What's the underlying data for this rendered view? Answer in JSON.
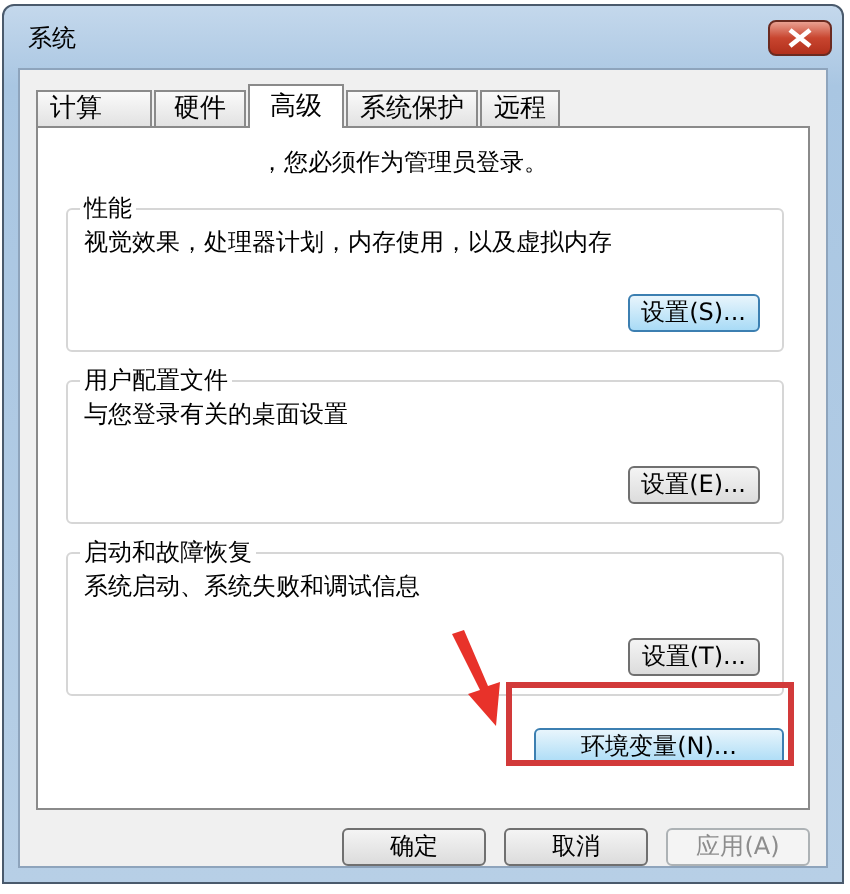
{
  "window": {
    "title": "系统"
  },
  "tabs": [
    {
      "label": "计算",
      "selected": false
    },
    {
      "label": "硬件",
      "selected": false
    },
    {
      "label": "高级",
      "selected": true
    },
    {
      "label": "系统保护",
      "selected": false
    },
    {
      "label": "远程",
      "selected": false
    }
  ],
  "notice": "，您必须作为管理员登录。",
  "groups": [
    {
      "title": "性能",
      "description": "视觉效果，处理器计划，内存使用，以及虚拟内存",
      "button": {
        "label": "设置(S)...",
        "focused": true
      }
    },
    {
      "title": "用户配置文件",
      "description": "与您登录有关的桌面设置",
      "button": {
        "label": "设置(E)...",
        "focused": false
      }
    },
    {
      "title": "启动和故障恢复",
      "description": "系统启动、系统失败和调试信息",
      "button": {
        "label": "设置(T)...",
        "focused": false
      }
    }
  ],
  "env_button": {
    "label": "环境变量(N)...",
    "focused": true
  },
  "buttons": [
    {
      "label": "确定",
      "disabled": false
    },
    {
      "label": "取消",
      "disabled": false
    },
    {
      "label": "应用(A)",
      "disabled": true
    }
  ]
}
